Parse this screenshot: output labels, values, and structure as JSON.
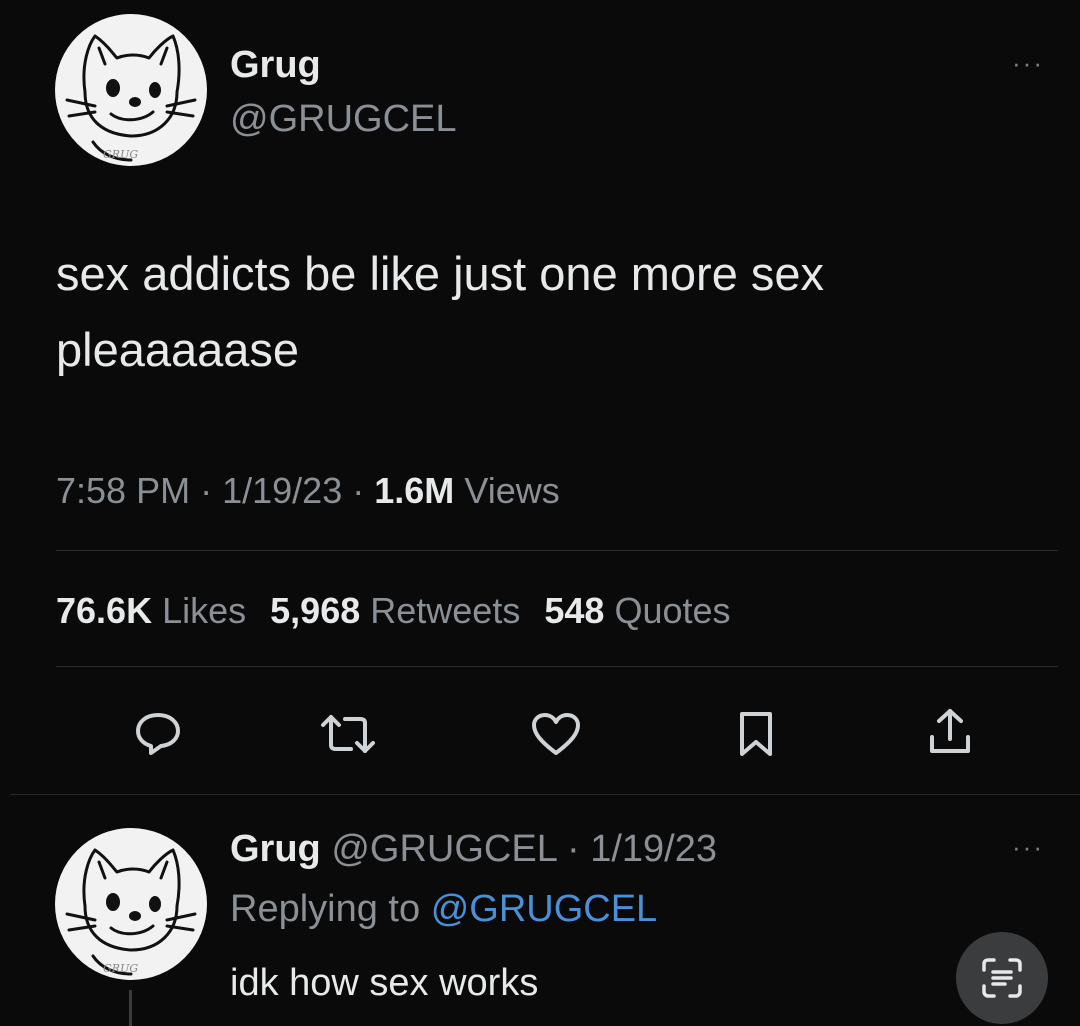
{
  "tweet": {
    "display_name": "Grug",
    "handle": "@GRUGCEL",
    "avatar_signature": "GRUG",
    "text_line1": "sex addicts be like just one more sex",
    "text_line2": "pleaaaaase",
    "time": "7:58 PM",
    "date": "1/19/23",
    "views_count": "1.6M",
    "views_label": "Views",
    "likes_count": "76.6K",
    "likes_label": "Likes",
    "retweets_count": "5,968",
    "retweets_label": "Retweets",
    "quotes_count": "548",
    "quotes_label": "Quotes",
    "sep": "·"
  },
  "actions": [
    "reply-icon",
    "retweet-icon",
    "like-icon",
    "bookmark-icon",
    "share-icon"
  ],
  "reply": {
    "display_name": "Grug",
    "handle_date": "@GRUGCEL · 1/19/23",
    "replying_prefix": "Replying to",
    "replying_handle": "@GRUGCEL",
    "text": "idk how sex works",
    "avatar_signature": "GRUG"
  },
  "more_label": "···",
  "colors": {
    "background": "#0a0a0a",
    "link": "#4b8fd6",
    "muted": "#8b9096"
  }
}
